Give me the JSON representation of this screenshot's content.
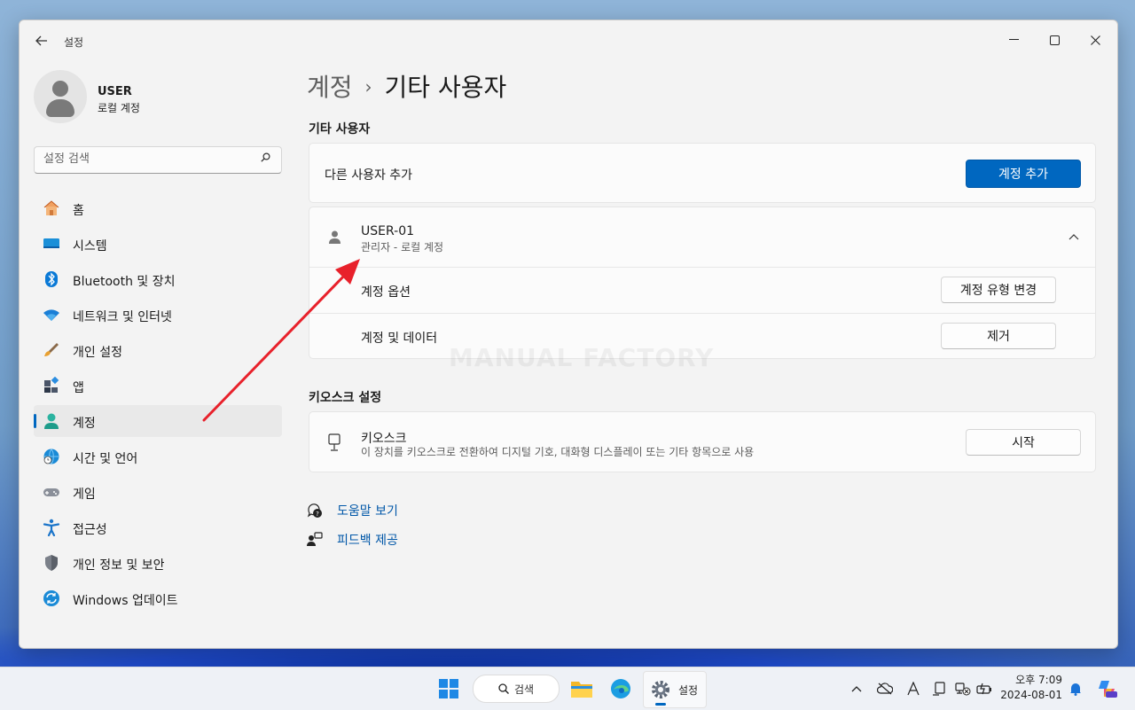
{
  "window": {
    "title": "설정",
    "controls": [
      "minimize",
      "maximize",
      "close"
    ]
  },
  "profile": {
    "name": "USER",
    "type": "로컬 계정"
  },
  "search": {
    "placeholder": "설정 검색"
  },
  "sidebar": {
    "items": [
      {
        "label": "홈",
        "icon": "home-icon"
      },
      {
        "label": "시스템",
        "icon": "system-icon"
      },
      {
        "label": "Bluetooth 및 장치",
        "icon": "bluetooth-icon"
      },
      {
        "label": "네트워크 및 인터넷",
        "icon": "wifi-icon"
      },
      {
        "label": "개인 설정",
        "icon": "brush-icon"
      },
      {
        "label": "앱",
        "icon": "apps-icon"
      },
      {
        "label": "계정",
        "icon": "account-icon",
        "active": true
      },
      {
        "label": "시간 및 언어",
        "icon": "time-language-icon"
      },
      {
        "label": "게임",
        "icon": "gamepad-icon"
      },
      {
        "label": "접근성",
        "icon": "accessibility-icon"
      },
      {
        "label": "개인 정보 및 보안",
        "icon": "shield-icon"
      },
      {
        "label": "Windows 업데이트",
        "icon": "update-icon"
      }
    ]
  },
  "breadcrumb": {
    "parent": "계정",
    "separator": "›",
    "current": "기타 사용자"
  },
  "other_users": {
    "section_title": "기타 사용자",
    "add_label": "다른 사용자 추가",
    "add_button": "계정 추가",
    "user": {
      "name": "USER-01",
      "detail": "관리자 - 로컬 계정",
      "options_label": "계정 옵션",
      "options_button": "계정 유형 변경",
      "data_label": "계정 및 데이터",
      "remove_button": "제거"
    }
  },
  "kiosk": {
    "section_title": "키오스크 설정",
    "title": "키오스크",
    "description": "이 장치를 키오스크로 전환하여 디지털 기호, 대화형 디스플레이 또는 기타 항목으로 사용",
    "start_button": "시작"
  },
  "links": {
    "help": "도움말 보기",
    "feedback": "피드백 제공"
  },
  "watermark": "MANUAL FACTORY",
  "taskbar": {
    "search_label": "검색",
    "settings_label": "설정",
    "time": "오후 7:09",
    "date": "2024-08-01"
  },
  "colors": {
    "accent": "#0067c0",
    "link": "#0057a8",
    "annotation_arrow": "#e8212b"
  }
}
